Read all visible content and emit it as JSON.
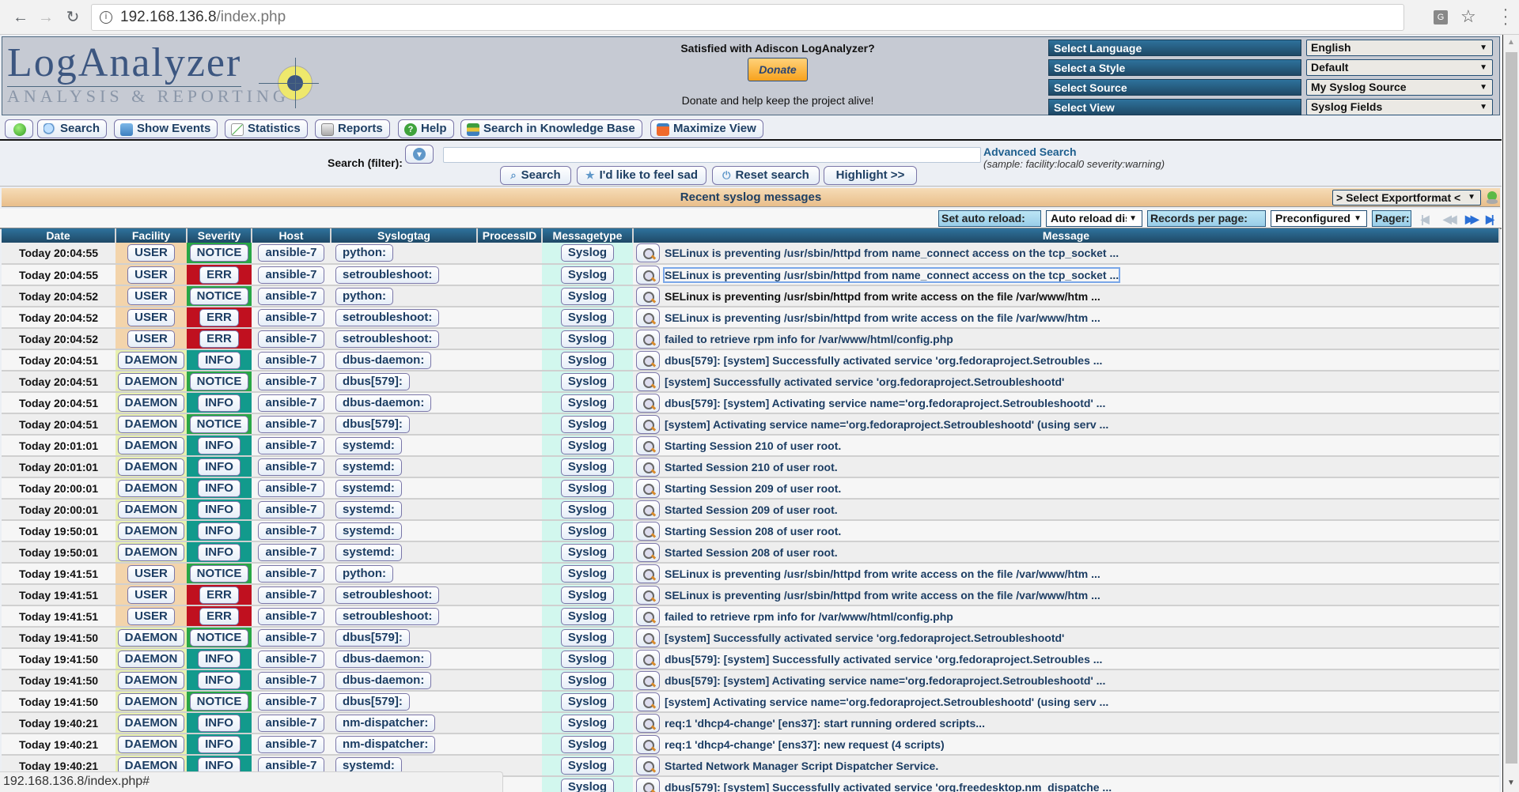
{
  "browser": {
    "url_host": "192.168.136.8",
    "url_path": "/index.php",
    "status_url": "192.168.136.8/index.php#"
  },
  "header": {
    "logo_title": "LogAnalyzer",
    "logo_subtitle": "ANALYSIS & REPORTING",
    "donate_question": "Satisfied with Adiscon LogAnalyzer?",
    "donate_button": "Donate",
    "donate_text": "Donate and help keep the project alive!",
    "selectors": [
      {
        "label": "Select Language",
        "value": "English"
      },
      {
        "label": "Select a Style",
        "value": "Default"
      },
      {
        "label": "Select Source",
        "value": "My Syslog Source"
      },
      {
        "label": "Select View",
        "value": "Syslog Fields"
      }
    ]
  },
  "toolbar": {
    "items": [
      {
        "label": "",
        "icon": "green-status-icon"
      },
      {
        "label": "Search",
        "icon": "magnifier-icon"
      },
      {
        "label": "Show Events",
        "icon": "home-icon"
      },
      {
        "label": "Statistics",
        "icon": "chart-icon"
      },
      {
        "label": "Reports",
        "icon": "report-icon"
      },
      {
        "label": "Help",
        "icon": "help-icon"
      },
      {
        "label": "Search in Knowledge Base",
        "icon": "books-icon"
      },
      {
        "label": "Maximize View",
        "icon": "maximize-icon"
      }
    ]
  },
  "search": {
    "label": "Search (filter):",
    "value": "",
    "advanced_link": "Advanced Search",
    "sample": "(sample: facility:local0 severity:warning)",
    "buttons": {
      "search": "Search",
      "feel_sad": "I'd like to feel sad",
      "reset": "Reset search",
      "highlight": "Highlight >>"
    }
  },
  "results": {
    "title": "Recent syslog messages",
    "export_format": "> Select Exportformat <",
    "auto_reload_label": "Set auto reload:",
    "auto_reload_value": "Auto reload dis",
    "records_label": "Records per page:",
    "records_value": "Preconfigured",
    "pager_label": "Pager:"
  },
  "table": {
    "columns": [
      "Date",
      "Facility",
      "Severity",
      "Host",
      "Syslogtag",
      "ProcessID",
      "Messagetype",
      "Message"
    ],
    "rows": [
      {
        "date": "Today 20:04:55",
        "facility": "USER",
        "severity": "NOTICE",
        "host": "ansible-7",
        "tag": "python:",
        "pid": "",
        "mtype": "Syslog",
        "message": "SELinux is preventing /usr/sbin/httpd from name_connect access on the tcp_socket ..."
      },
      {
        "date": "Today 20:04:55",
        "facility": "USER",
        "severity": "ERR",
        "host": "ansible-7",
        "tag": "setroubleshoot:",
        "pid": "",
        "mtype": "Syslog",
        "message": "SELinux is preventing /usr/sbin/httpd from name_connect access on the tcp_socket ..."
      },
      {
        "date": "Today 20:04:52",
        "facility": "USER",
        "severity": "NOTICE",
        "host": "ansible-7",
        "tag": "python:",
        "pid": "",
        "mtype": "Syslog",
        "message": "SELinux is preventing /usr/sbin/httpd from write access on the file /var/www/htm ..."
      },
      {
        "date": "Today 20:04:52",
        "facility": "USER",
        "severity": "ERR",
        "host": "ansible-7",
        "tag": "setroubleshoot:",
        "pid": "",
        "mtype": "Syslog",
        "message": "SELinux is preventing /usr/sbin/httpd from write access on the file /var/www/htm ..."
      },
      {
        "date": "Today 20:04:52",
        "facility": "USER",
        "severity": "ERR",
        "host": "ansible-7",
        "tag": "setroubleshoot:",
        "pid": "",
        "mtype": "Syslog",
        "message": "failed to retrieve rpm info for /var/www/html/config.php"
      },
      {
        "date": "Today 20:04:51",
        "facility": "DAEMON",
        "severity": "INFO",
        "host": "ansible-7",
        "tag": "dbus-daemon:",
        "pid": "",
        "mtype": "Syslog",
        "message": "dbus[579]: [system] Successfully activated service 'org.fedoraproject.Setroubles ..."
      },
      {
        "date": "Today 20:04:51",
        "facility": "DAEMON",
        "severity": "NOTICE",
        "host": "ansible-7",
        "tag": "dbus[579]:",
        "pid": "",
        "mtype": "Syslog",
        "message": "[system] Successfully activated service 'org.fedoraproject.Setroubleshootd'"
      },
      {
        "date": "Today 20:04:51",
        "facility": "DAEMON",
        "severity": "INFO",
        "host": "ansible-7",
        "tag": "dbus-daemon:",
        "pid": "",
        "mtype": "Syslog",
        "message": "dbus[579]: [system] Activating service name='org.fedoraproject.Setroubleshootd' ..."
      },
      {
        "date": "Today 20:04:51",
        "facility": "DAEMON",
        "severity": "NOTICE",
        "host": "ansible-7",
        "tag": "dbus[579]:",
        "pid": "",
        "mtype": "Syslog",
        "message": "[system] Activating service name='org.fedoraproject.Setroubleshootd' (using serv ..."
      },
      {
        "date": "Today 20:01:01",
        "facility": "DAEMON",
        "severity": "INFO",
        "host": "ansible-7",
        "tag": "systemd:",
        "pid": "",
        "mtype": "Syslog",
        "message": "Starting Session 210 of user root."
      },
      {
        "date": "Today 20:01:01",
        "facility": "DAEMON",
        "severity": "INFO",
        "host": "ansible-7",
        "tag": "systemd:",
        "pid": "",
        "mtype": "Syslog",
        "message": "Started Session 210 of user root."
      },
      {
        "date": "Today 20:00:01",
        "facility": "DAEMON",
        "severity": "INFO",
        "host": "ansible-7",
        "tag": "systemd:",
        "pid": "",
        "mtype": "Syslog",
        "message": "Starting Session 209 of user root."
      },
      {
        "date": "Today 20:00:01",
        "facility": "DAEMON",
        "severity": "INFO",
        "host": "ansible-7",
        "tag": "systemd:",
        "pid": "",
        "mtype": "Syslog",
        "message": "Started Session 209 of user root."
      },
      {
        "date": "Today 19:50:01",
        "facility": "DAEMON",
        "severity": "INFO",
        "host": "ansible-7",
        "tag": "systemd:",
        "pid": "",
        "mtype": "Syslog",
        "message": "Starting Session 208 of user root."
      },
      {
        "date": "Today 19:50:01",
        "facility": "DAEMON",
        "severity": "INFO",
        "host": "ansible-7",
        "tag": "systemd:",
        "pid": "",
        "mtype": "Syslog",
        "message": "Started Session 208 of user root."
      },
      {
        "date": "Today 19:41:51",
        "facility": "USER",
        "severity": "NOTICE",
        "host": "ansible-7",
        "tag": "python:",
        "pid": "",
        "mtype": "Syslog",
        "message": "SELinux is preventing /usr/sbin/httpd from write access on the file /var/www/htm ..."
      },
      {
        "date": "Today 19:41:51",
        "facility": "USER",
        "severity": "ERR",
        "host": "ansible-7",
        "tag": "setroubleshoot:",
        "pid": "",
        "mtype": "Syslog",
        "message": "SELinux is preventing /usr/sbin/httpd from write access on the file /var/www/htm ..."
      },
      {
        "date": "Today 19:41:51",
        "facility": "USER",
        "severity": "ERR",
        "host": "ansible-7",
        "tag": "setroubleshoot:",
        "pid": "",
        "mtype": "Syslog",
        "message": "failed to retrieve rpm info for /var/www/html/config.php"
      },
      {
        "date": "Today 19:41:50",
        "facility": "DAEMON",
        "severity": "NOTICE",
        "host": "ansible-7",
        "tag": "dbus[579]:",
        "pid": "",
        "mtype": "Syslog",
        "message": "[system] Successfully activated service 'org.fedoraproject.Setroubleshootd'"
      },
      {
        "date": "Today 19:41:50",
        "facility": "DAEMON",
        "severity": "INFO",
        "host": "ansible-7",
        "tag": "dbus-daemon:",
        "pid": "",
        "mtype": "Syslog",
        "message": "dbus[579]: [system] Successfully activated service 'org.fedoraproject.Setroubles ..."
      },
      {
        "date": "Today 19:41:50",
        "facility": "DAEMON",
        "severity": "INFO",
        "host": "ansible-7",
        "tag": "dbus-daemon:",
        "pid": "",
        "mtype": "Syslog",
        "message": "dbus[579]: [system] Activating service name='org.fedoraproject.Setroubleshootd' ..."
      },
      {
        "date": "Today 19:41:50",
        "facility": "DAEMON",
        "severity": "NOTICE",
        "host": "ansible-7",
        "tag": "dbus[579]:",
        "pid": "",
        "mtype": "Syslog",
        "message": "[system] Activating service name='org.fedoraproject.Setroubleshootd' (using serv ..."
      },
      {
        "date": "Today 19:40:21",
        "facility": "DAEMON",
        "severity": "INFO",
        "host": "ansible-7",
        "tag": "nm-dispatcher:",
        "pid": "",
        "mtype": "Syslog",
        "message": "req:1 'dhcp4-change' [ens37]: start running ordered scripts..."
      },
      {
        "date": "Today 19:40:21",
        "facility": "DAEMON",
        "severity": "INFO",
        "host": "ansible-7",
        "tag": "nm-dispatcher:",
        "pid": "",
        "mtype": "Syslog",
        "message": "req:1 'dhcp4-change' [ens37]: new request (4 scripts)"
      },
      {
        "date": "Today 19:40:21",
        "facility": "DAEMON",
        "severity": "INFO",
        "host": "ansible-7",
        "tag": "systemd:",
        "pid": "",
        "mtype": "Syslog",
        "message": "Started Network Manager Script Dispatcher Service."
      },
      {
        "date": "",
        "facility": "",
        "severity": "",
        "host": "",
        "tag": "",
        "pid": "",
        "mtype": "Syslog",
        "message": "dbus[579]: [system] Successfully activated service 'org.freedesktop.nm_dispatche ..."
      }
    ]
  },
  "colors": {
    "header_bar": "#2e729c",
    "severity_notice": "#28a745",
    "severity_err": "#c0101f",
    "severity_info": "#129a8c",
    "facility_user": "#f3d4ab",
    "facility_daemon": "#e8f0b0",
    "messagetype": "#d2f7ee"
  }
}
